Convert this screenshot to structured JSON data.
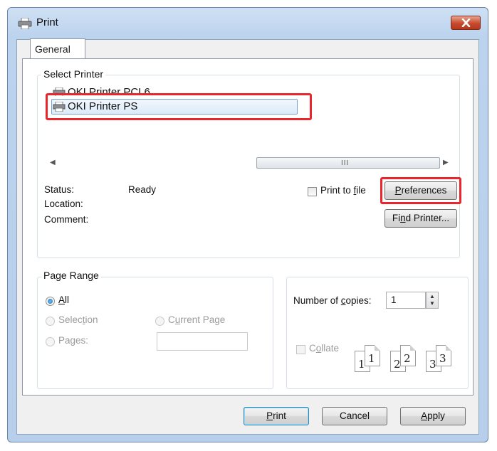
{
  "window": {
    "title": "Print",
    "close_icon": "close-icon"
  },
  "tabs": [
    {
      "label": "General"
    }
  ],
  "select_printer": {
    "legend": "Select Printer",
    "printers": [
      {
        "name": "OKI Printer PCL6",
        "selected": false
      },
      {
        "name": "OKI Printer PS",
        "selected": true
      }
    ],
    "scrollbar_grip": "III",
    "status_label": "Status:",
    "status_value": "Ready",
    "location_label": "Location:",
    "comment_label": "Comment:",
    "print_to_file_pre": "Print to ",
    "print_to_file_key": "f",
    "print_to_file_post": "ile",
    "preferences_key": "P",
    "preferences_rest": "references",
    "find_printer_pre": "Fi",
    "find_printer_key": "n",
    "find_printer_post": "d Printer..."
  },
  "page_range": {
    "legend": "Page Range",
    "all_key": "A",
    "all_rest": "ll",
    "selection_pre": "Selec",
    "selection_key": "t",
    "selection_post": "ion",
    "current_page_pre": "C",
    "current_page_key": "u",
    "current_page_post": "rrent Page",
    "pages_pre": "Pa",
    "pages_key": "g",
    "pages_post": "es:",
    "pages_value": "",
    "selected_option": "All"
  },
  "copies": {
    "label_pre": "Number of ",
    "label_key": "c",
    "label_post": "opies:",
    "value": "1",
    "collate_pre": "C",
    "collate_key": "o",
    "collate_post": "llate",
    "collate_checked": false,
    "page_icons": [
      {
        "back": "1",
        "front": "1"
      },
      {
        "back": "2",
        "front": "2"
      },
      {
        "back": "3",
        "front": "3"
      }
    ]
  },
  "buttons": {
    "print_key": "P",
    "print_rest": "rint",
    "cancel": "Cancel",
    "apply_key": "A",
    "apply_rest": "pply"
  },
  "colors": {
    "highlight": "#e8262c",
    "selection_accent": "#1f6fb6"
  }
}
